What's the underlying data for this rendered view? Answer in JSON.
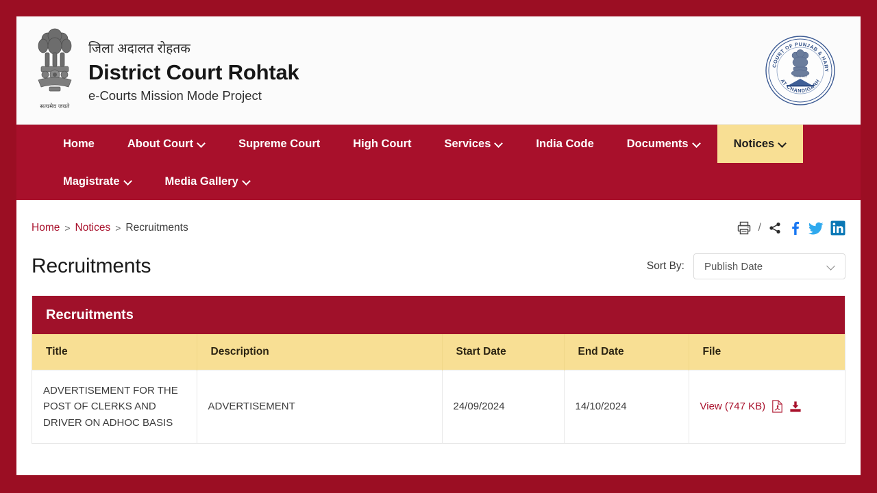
{
  "brand": {
    "hindi_title": "जिला अदालत रोहतक",
    "title": "District Court Rohtak",
    "subtitle": "e-Courts Mission Mode Project",
    "emblem_motto": "सत्यमेव जयते",
    "seal_top_text": "HIGH COURT OF PUNJAB & HARYANA",
    "seal_bottom_text": "AT CHANDIGARH"
  },
  "nav": {
    "row1": [
      {
        "label": "Home",
        "has_caret": false,
        "active": false
      },
      {
        "label": "About Court",
        "has_caret": true,
        "active": false
      },
      {
        "label": "Supreme Court",
        "has_caret": false,
        "active": false
      },
      {
        "label": "High Court",
        "has_caret": false,
        "active": false
      },
      {
        "label": "Services",
        "has_caret": true,
        "active": false
      },
      {
        "label": "India Code",
        "has_caret": false,
        "active": false
      },
      {
        "label": "Documents",
        "has_caret": true,
        "active": false
      },
      {
        "label": "Notices",
        "has_caret": true,
        "active": true
      }
    ],
    "row2": [
      {
        "label": "Magistrate",
        "has_caret": true,
        "active": false
      },
      {
        "label": "Media Gallery",
        "has_caret": true,
        "active": false
      }
    ]
  },
  "breadcrumb": {
    "home": "Home",
    "sep": ">",
    "notices": "Notices",
    "current": "Recruitments"
  },
  "share": {
    "print": "print-icon",
    "slash": "/",
    "share": "share-icon",
    "facebook": "facebook-icon",
    "twitter": "twitter-icon",
    "linkedin": "linkedin-icon"
  },
  "page_title": "Recruitments",
  "sort": {
    "label": "Sort By:",
    "value": "Publish Date",
    "options": [
      "Publish Date"
    ]
  },
  "table": {
    "caption": "Recruitments",
    "columns": [
      "Title",
      "Description",
      "Start Date",
      "End Date",
      "File"
    ],
    "rows": [
      {
        "title": "ADVERTISEMENT FOR THE POST OF CLERKS AND DRIVER ON ADHOC BASIS",
        "description": "ADVERTISEMENT",
        "start_date": "24/09/2024",
        "end_date": "14/10/2024",
        "file_label": "View (747 KB)",
        "file_icon": "pdf-icon",
        "download_icon": "download-icon"
      }
    ]
  },
  "colors": {
    "page_background": "#9B0E23",
    "nav_background": "#A8102B",
    "accent_maroon": "#A0112A",
    "highlight_yellow": "#F8DF94",
    "link_maroon": "#A8102B"
  }
}
